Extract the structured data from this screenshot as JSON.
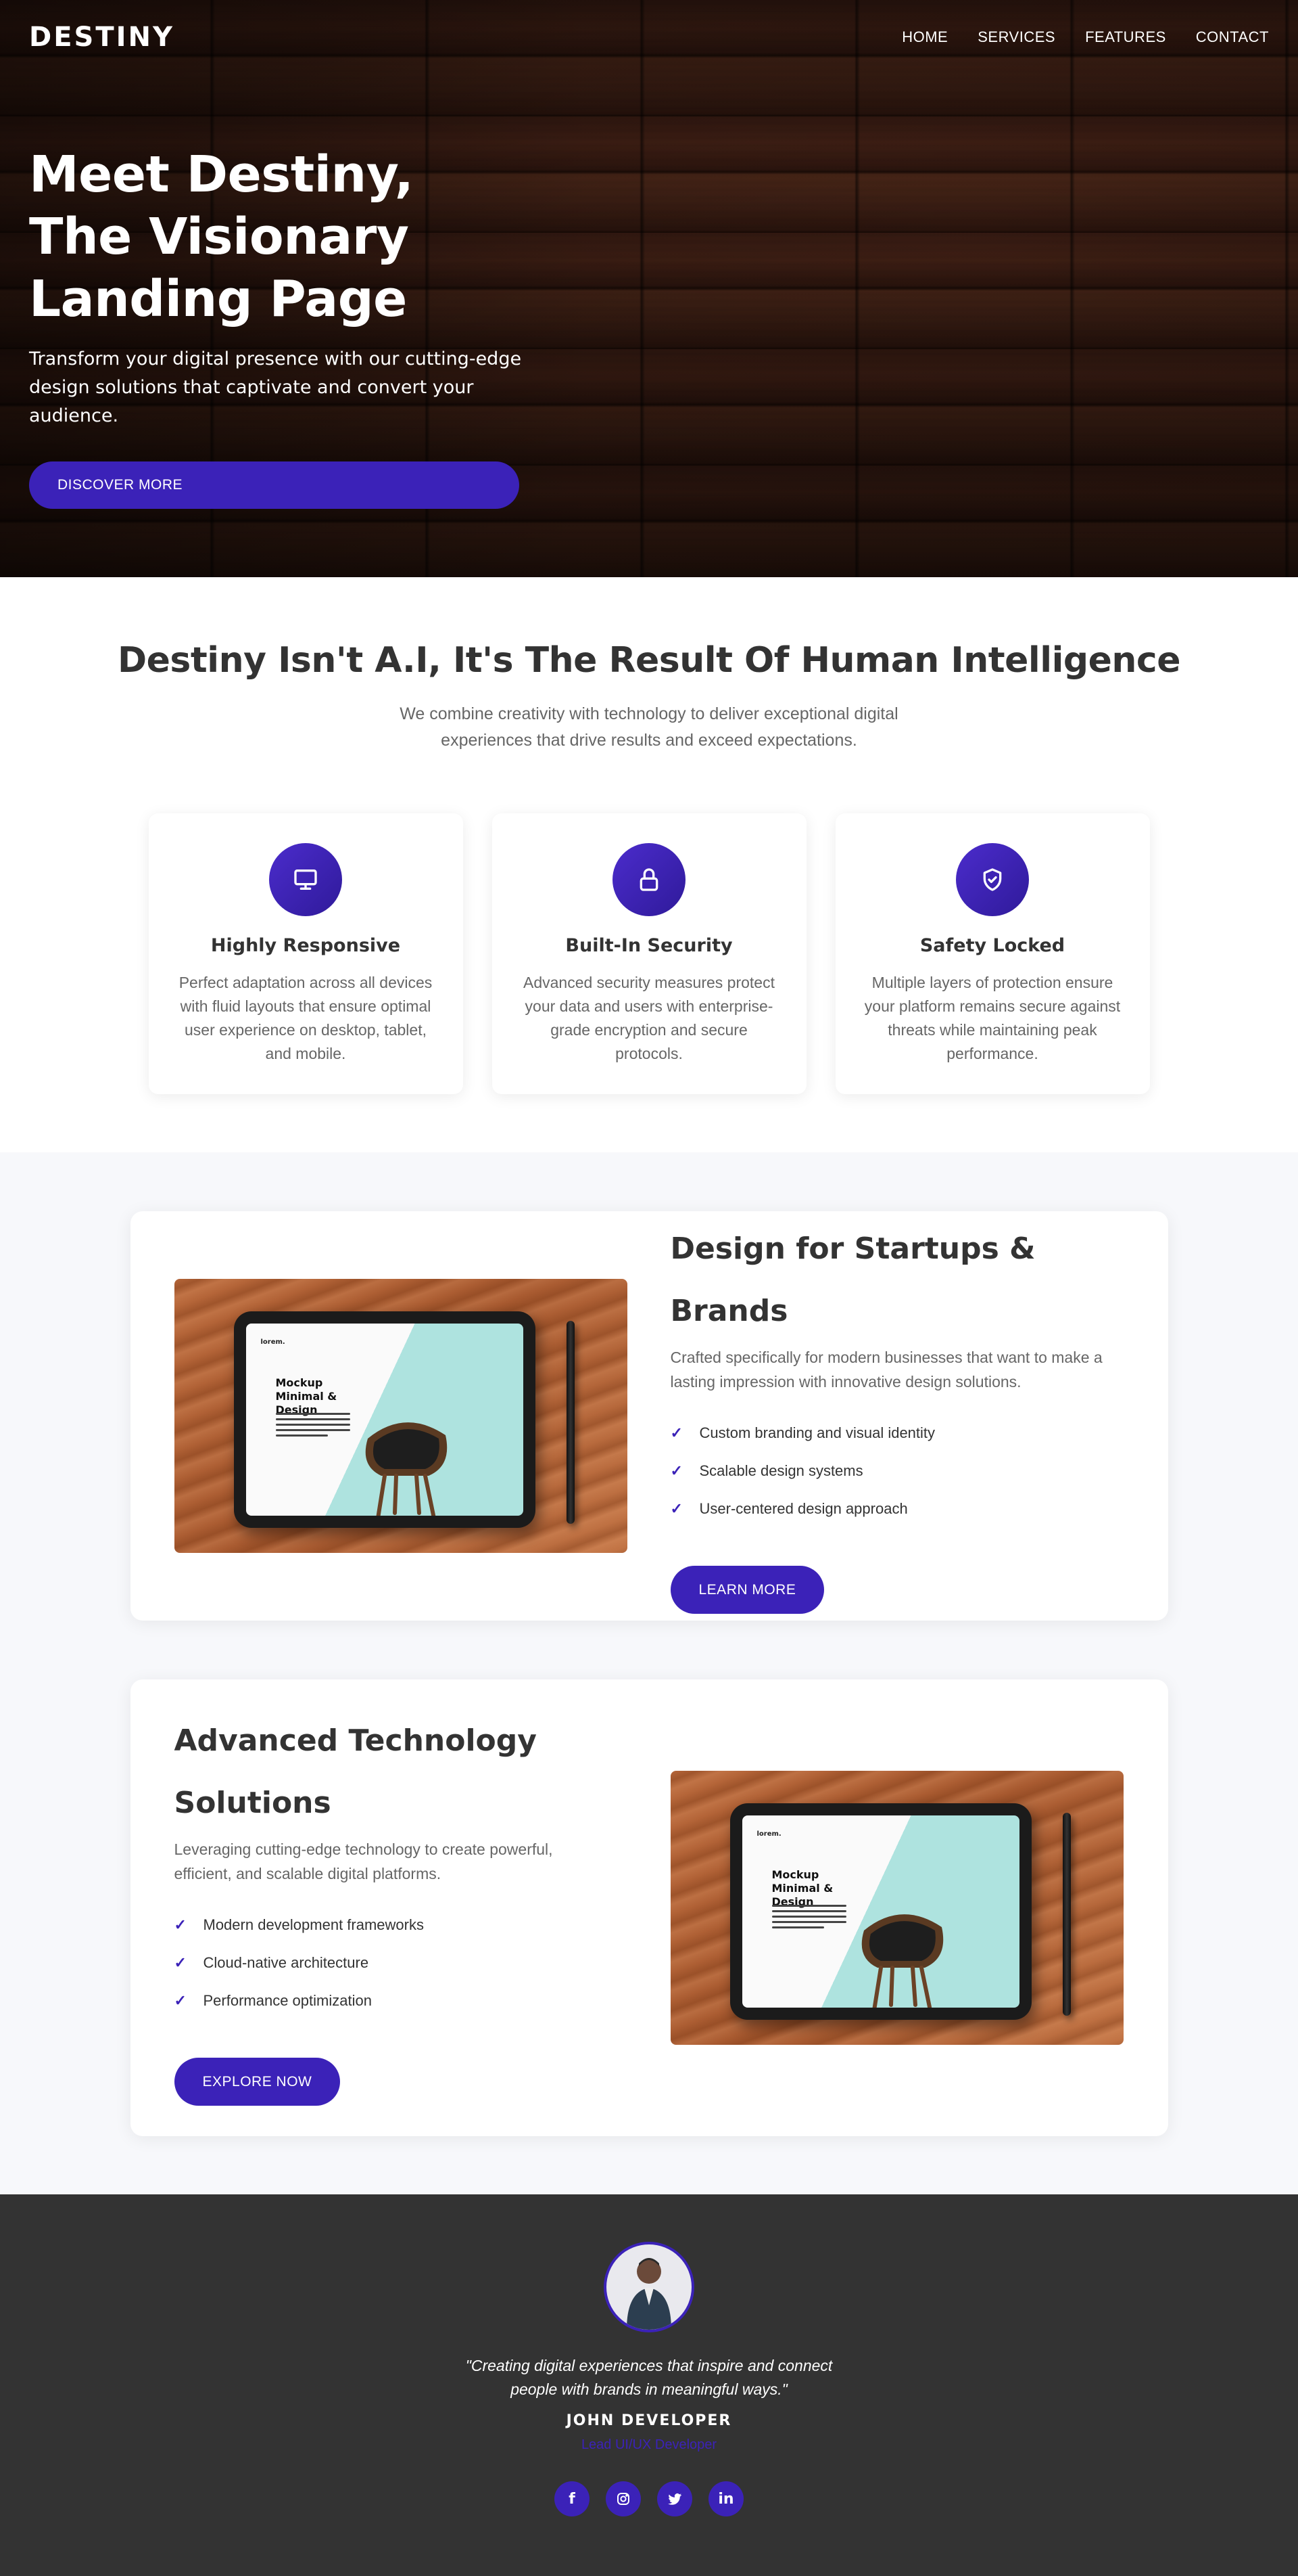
{
  "nav": {
    "logo": "DESTINY",
    "links": [
      "HOME",
      "SERVICES",
      "FEATURES",
      "CONTACT"
    ]
  },
  "hero": {
    "title": "Meet Destiny, The Visionary Landing Page",
    "subtitle": "Transform your digital presence with our cutting-edge design solutions that captivate and convert your audience.",
    "button": "DISCOVER MORE"
  },
  "intro": {
    "title": "Destiny Isn't A.I, It's The Result Of Human Intelligence",
    "text": "We combine creativity with technology to deliver exceptional digital experiences that drive results and exceed expectations."
  },
  "features": [
    {
      "icon": "monitor-icon",
      "title": "Highly Responsive",
      "text": "Perfect adaptation across all devices with fluid layouts that ensure optimal user experience on desktop, tablet, and mobile."
    },
    {
      "icon": "lock-icon",
      "title": "Built-In Security",
      "text": "Advanced security measures protect your data and users with enterprise-grade encryption and secure protocols."
    },
    {
      "icon": "shield-check-icon",
      "title": "Safety Locked",
      "text": "Multiple layers of protection ensure your platform remains secure against threats while maintaining peak performance."
    }
  ],
  "mockup": {
    "brand": "lorem.",
    "title": "Mockup Minimal & Design"
  },
  "startups": {
    "title": "Design for Startups & Brands",
    "text": "Crafted specifically for modern businesses that want to make a lasting impression with innovative design solutions.",
    "items": [
      "Custom branding and visual identity",
      "Scalable design systems",
      "User-centered design approach"
    ],
    "button": "LEARN MORE"
  },
  "technology": {
    "title": "Advanced Technology Solutions",
    "text": "Leveraging cutting-edge technology to create powerful, efficient, and scalable digital platforms.",
    "items": [
      "Modern development frameworks",
      "Cloud-native architecture",
      "Performance optimization"
    ],
    "button": "EXPLORE NOW"
  },
  "footer": {
    "quote": "\"Creating digital experiences that inspire and connect people with brands in meaningful ways.\"",
    "name": "JOHN DEVELOPER",
    "role": "Lead UI/UX Developer",
    "socials": [
      {
        "icon": "facebook-icon",
        "glyph": "f"
      },
      {
        "icon": "instagram-icon",
        "glyph": ""
      },
      {
        "icon": "twitter-icon",
        "glyph": ""
      },
      {
        "icon": "linkedin-icon",
        "glyph": "in"
      }
    ]
  },
  "colors": {
    "accent": "#3b22b8",
    "dark": "#333333",
    "light_bg": "#f7f8fb"
  }
}
